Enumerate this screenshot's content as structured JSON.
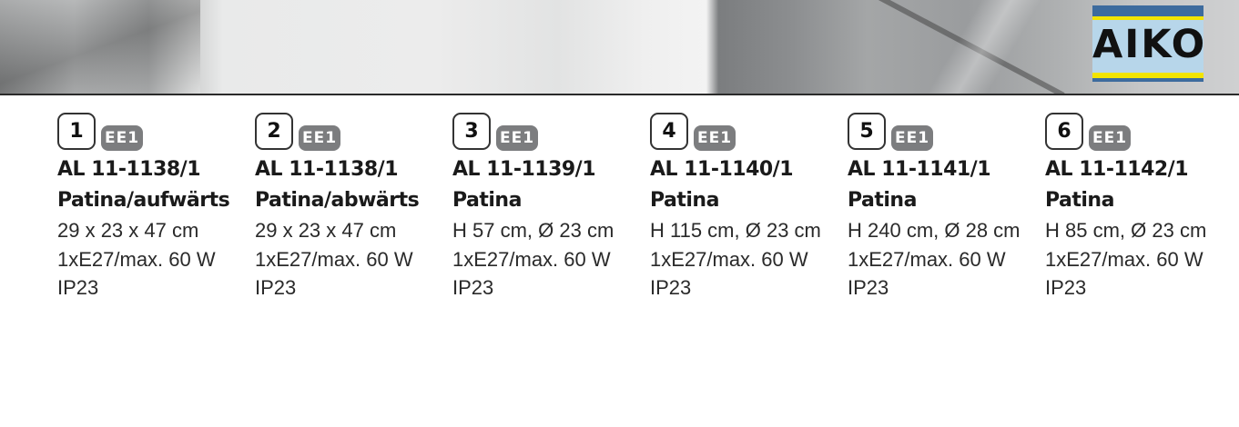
{
  "brand": {
    "name": "AIKO"
  },
  "products": [
    {
      "number": "1",
      "badge": "EE1",
      "code": "AL 11-1138/1",
      "finish": "Patina/aufwärts",
      "dimensions": "29 x 23 x 47 cm",
      "power": "1xE27/max. 60 W",
      "ip": "IP23"
    },
    {
      "number": "2",
      "badge": "EE1",
      "code": "AL 11-1138/1",
      "finish": "Patina/abwärts",
      "dimensions": "29 x 23 x 47 cm",
      "power": "1xE27/max. 60 W",
      "ip": "IP23"
    },
    {
      "number": "3",
      "badge": "EE1",
      "code": "AL 11-1139/1",
      "finish": "Patina",
      "dimensions": "H 57 cm, Ø 23 cm",
      "power": "1xE27/max. 60 W",
      "ip": "IP23"
    },
    {
      "number": "4",
      "badge": "EE1",
      "code": "AL 11-1140/1",
      "finish": "Patina",
      "dimensions": "H 115 cm, Ø 23 cm",
      "power": "1xE27/max. 60 W",
      "ip": "IP23"
    },
    {
      "number": "5",
      "badge": "EE1",
      "code": "AL 11-1141/1",
      "finish": "Patina",
      "dimensions": "H 240 cm, Ø 28 cm",
      "power": "1xE27/max. 60 W",
      "ip": "IP23"
    },
    {
      "number": "6",
      "badge": "EE1",
      "code": "AL 11-1142/1",
      "finish": "Patina",
      "dimensions": "H 85 cm, Ø 23 cm",
      "power": "1xE27/max. 60 W",
      "ip": "IP23"
    }
  ],
  "colors": {
    "badge": "#7c7d7f",
    "logo_blue": "#3d6b9e",
    "logo_yellow": "#f2e400",
    "logo_light": "#b7d6ea"
  }
}
